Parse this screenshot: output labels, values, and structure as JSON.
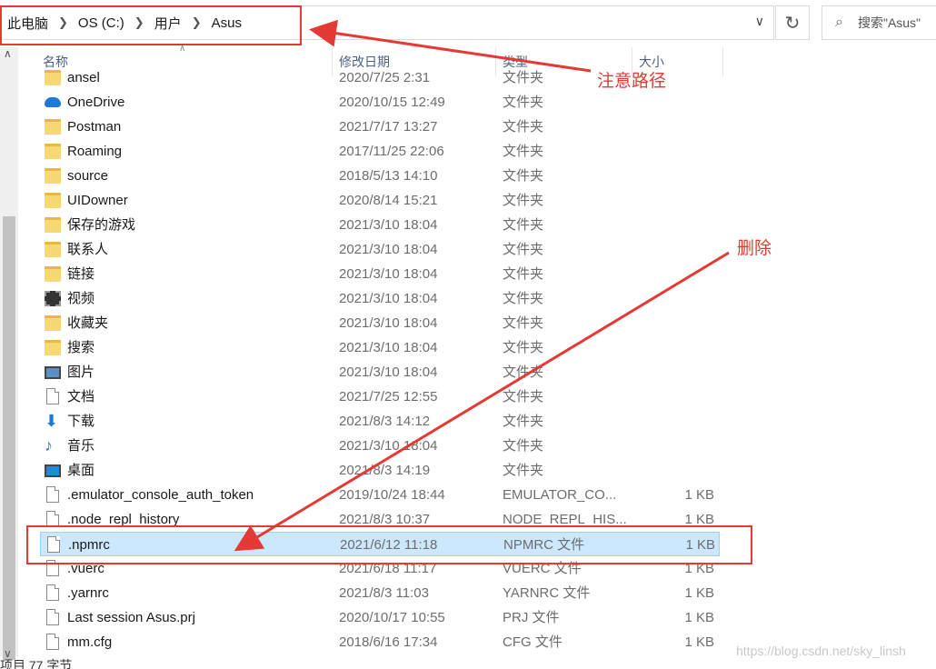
{
  "address": {
    "crumbs": [
      "此电脑",
      "OS (C:)",
      "用户",
      "Asus"
    ]
  },
  "search": {
    "placeholder": "搜索\"Asus\""
  },
  "columns": {
    "name": "名称",
    "date": "修改日期",
    "type": "类型",
    "size": "大小"
  },
  "files": [
    {
      "name": "ansel",
      "date": "2020/7/25 2:31",
      "type": "文件夹",
      "size": "",
      "icon": "folder-icon"
    },
    {
      "name": "OneDrive",
      "date": "2020/10/15 12:49",
      "type": "文件夹",
      "size": "",
      "icon": "onedrive-icon"
    },
    {
      "name": "Postman",
      "date": "2021/7/17 13:27",
      "type": "文件夹",
      "size": "",
      "icon": "folder-icon"
    },
    {
      "name": "Roaming",
      "date": "2017/11/25 22:06",
      "type": "文件夹",
      "size": "",
      "icon": "folder-icon"
    },
    {
      "name": "source",
      "date": "2018/5/13 14:10",
      "type": "文件夹",
      "size": "",
      "icon": "folder-icon"
    },
    {
      "name": "UIDowner",
      "date": "2020/8/14 15:21",
      "type": "文件夹",
      "size": "",
      "icon": "folder-icon"
    },
    {
      "name": "保存的游戏",
      "date": "2021/3/10 18:04",
      "type": "文件夹",
      "size": "",
      "icon": "saved-games-icon"
    },
    {
      "name": "联系人",
      "date": "2021/3/10 18:04",
      "type": "文件夹",
      "size": "",
      "icon": "contacts-icon"
    },
    {
      "name": "链接",
      "date": "2021/3/10 18:04",
      "type": "文件夹",
      "size": "",
      "icon": "links-icon"
    },
    {
      "name": "视频",
      "date": "2021/3/10 18:04",
      "type": "文件夹",
      "size": "",
      "icon": "videos-icon"
    },
    {
      "name": "收藏夹",
      "date": "2021/3/10 18:04",
      "type": "文件夹",
      "size": "",
      "icon": "favorites-icon"
    },
    {
      "name": "搜索",
      "date": "2021/3/10 18:04",
      "type": "文件夹",
      "size": "",
      "icon": "searches-icon"
    },
    {
      "name": "图片",
      "date": "2021/3/10 18:04",
      "type": "文件夹",
      "size": "",
      "icon": "pictures-icon"
    },
    {
      "name": "文档",
      "date": "2021/7/25 12:55",
      "type": "文件夹",
      "size": "",
      "icon": "documents-icon"
    },
    {
      "name": "下载",
      "date": "2021/8/3 14:12",
      "type": "文件夹",
      "size": "",
      "icon": "downloads-icon"
    },
    {
      "name": "音乐",
      "date": "2021/3/10 18:04",
      "type": "文件夹",
      "size": "",
      "icon": "music-icon"
    },
    {
      "name": "桌面",
      "date": "2021/8/3 14:19",
      "type": "文件夹",
      "size": "",
      "icon": "desktop-icon"
    },
    {
      "name": ".emulator_console_auth_token",
      "date": "2019/10/24 18:44",
      "type": "EMULATOR_CO...",
      "size": "1 KB",
      "icon": "file-icon"
    },
    {
      "name": ".node_repl_history",
      "date": "2021/8/3 10:37",
      "type": "NODE_REPL_HIS...",
      "size": "1 KB",
      "icon": "file-icon"
    },
    {
      "name": ".npmrc",
      "date": "2021/6/12 11:18",
      "type": "NPMRC 文件",
      "size": "1 KB",
      "icon": "file-icon",
      "selected": true
    },
    {
      "name": ".vuerc",
      "date": "2021/6/18 11:17",
      "type": "VUERC 文件",
      "size": "1 KB",
      "icon": "file-icon"
    },
    {
      "name": ".yarnrc",
      "date": "2021/8/3 11:03",
      "type": "YARNRC 文件",
      "size": "1 KB",
      "icon": "file-icon"
    },
    {
      "name": "Last session Asus.prj",
      "date": "2020/10/17 10:55",
      "type": "PRJ 文件",
      "size": "1 KB",
      "icon": "file-icon"
    },
    {
      "name": "mm.cfg",
      "date": "2018/6/16 17:34",
      "type": "CFG 文件",
      "size": "1 KB",
      "icon": "file-icon"
    }
  ],
  "annotations": {
    "path_note": "注意路径",
    "delete_note": "删除"
  },
  "status_text": "项目 77 字节",
  "watermark": "https://blog.csdn.net/sky_linsh",
  "colors": {
    "annotation": "#e53935",
    "selection": "#cce8ff"
  }
}
